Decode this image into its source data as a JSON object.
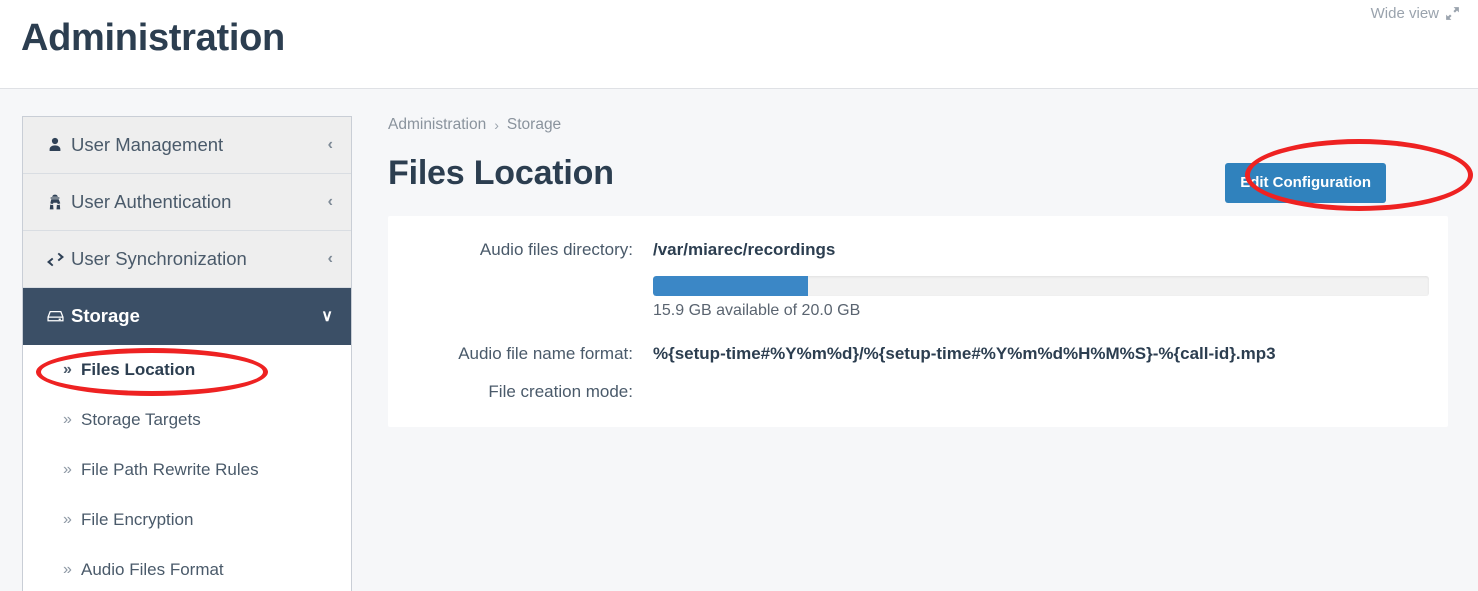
{
  "header": {
    "title": "Administration",
    "wide_view_label": "Wide view",
    "wide_view_icon": "expand-arrows-icon"
  },
  "sidebar": {
    "items": [
      {
        "label": "User Management",
        "icon": "user-icon",
        "caret": "‹",
        "active": false
      },
      {
        "label": "User Authentication",
        "icon": "user-secret-icon",
        "caret": "‹",
        "active": false
      },
      {
        "label": "User Synchronization",
        "icon": "exchange-icon",
        "caret": "‹",
        "active": false
      },
      {
        "label": "Storage",
        "icon": "hdd-icon",
        "caret": "∨",
        "active": true
      }
    ],
    "sub_items": [
      {
        "label": "Files Location",
        "chevron": "»",
        "current": true
      },
      {
        "label": "Storage Targets",
        "chevron": "»",
        "current": false
      },
      {
        "label": "File Path Rewrite Rules",
        "chevron": "»",
        "current": false
      },
      {
        "label": "File Encryption",
        "chevron": "»",
        "current": false
      },
      {
        "label": "Audio Files Format",
        "chevron": "»",
        "current": false
      }
    ]
  },
  "main": {
    "breadcrumb": {
      "root": "Administration",
      "separator": "›",
      "current": "Storage"
    },
    "title": "Files Location",
    "edit_button_label": "Edit Configuration",
    "fields": {
      "audio_dir_label": "Audio files directory:",
      "audio_dir_value": "/var/miarec/recordings",
      "name_format_label": "Audio file name format:",
      "name_format_value": "%{setup-time#%Y%m%d}/%{setup-time#%Y%m%d%H%M%S}-%{call-id}.mp3",
      "creation_mode_label": "File creation mode:",
      "creation_mode_value": ""
    },
    "disk_usage": {
      "caption": "15.9 GB available of 20.0 GB",
      "available_gb": 15.9,
      "total_gb": 20.0,
      "used_percent": 20
    }
  },
  "colors": {
    "accent_blue": "#3082bd",
    "progress_blue": "#3b87c6",
    "sidebar_active": "#3b4f66",
    "annotation_red": "#ee2222",
    "page_bg": "#f6f7f9"
  },
  "annotations": [
    {
      "name": "highlight-edit-configuration",
      "shape": "ellipse",
      "color": "#ee2222"
    },
    {
      "name": "highlight-files-location",
      "shape": "ellipse",
      "color": "#ee2222"
    }
  ]
}
